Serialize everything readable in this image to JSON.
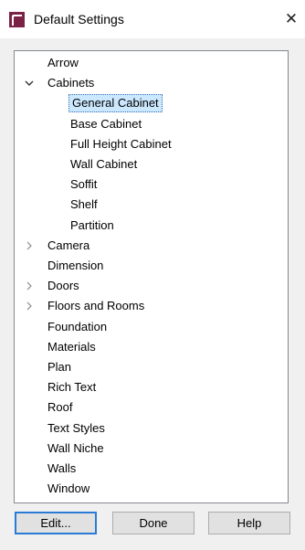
{
  "window": {
    "title": "Default Settings",
    "close_glyph": "✕",
    "icon": "app-icon",
    "accent_color": "#7b2145"
  },
  "tree": {
    "items": [
      {
        "label": "Arrow",
        "level": 0,
        "expander": ""
      },
      {
        "label": "Cabinets",
        "level": 0,
        "expander": "expanded"
      },
      {
        "label": "General Cabinet",
        "level": 1,
        "expander": "",
        "selected": true
      },
      {
        "label": "Base Cabinet",
        "level": 1,
        "expander": ""
      },
      {
        "label": "Full Height Cabinet",
        "level": 1,
        "expander": ""
      },
      {
        "label": "Wall Cabinet",
        "level": 1,
        "expander": ""
      },
      {
        "label": "Soffit",
        "level": 1,
        "expander": ""
      },
      {
        "label": "Shelf",
        "level": 1,
        "expander": ""
      },
      {
        "label": "Partition",
        "level": 1,
        "expander": ""
      },
      {
        "label": "Camera",
        "level": 0,
        "expander": "collapsed"
      },
      {
        "label": "Dimension",
        "level": 0,
        "expander": ""
      },
      {
        "label": "Doors",
        "level": 0,
        "expander": "collapsed"
      },
      {
        "label": "Floors and Rooms",
        "level": 0,
        "expander": "collapsed"
      },
      {
        "label": "Foundation",
        "level": 0,
        "expander": ""
      },
      {
        "label": "Materials",
        "level": 0,
        "expander": ""
      },
      {
        "label": "Plan",
        "level": 0,
        "expander": ""
      },
      {
        "label": "Rich Text",
        "level": 0,
        "expander": ""
      },
      {
        "label": "Roof",
        "level": 0,
        "expander": ""
      },
      {
        "label": "Text Styles",
        "level": 0,
        "expander": ""
      },
      {
        "label": "Wall Niche",
        "level": 0,
        "expander": ""
      },
      {
        "label": "Walls",
        "level": 0,
        "expander": ""
      },
      {
        "label": "Window",
        "level": 0,
        "expander": ""
      }
    ]
  },
  "buttons": {
    "edit": "Edit...",
    "done": "Done",
    "help": "Help"
  }
}
